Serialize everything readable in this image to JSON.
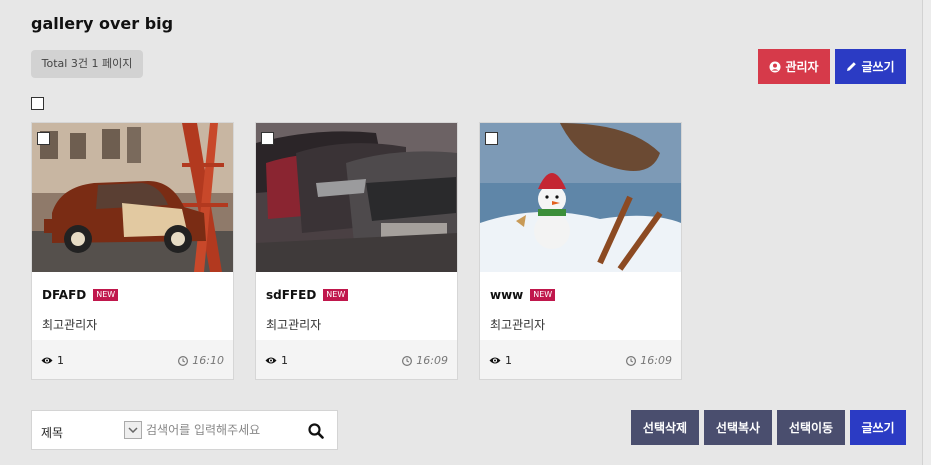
{
  "board": {
    "title": "gallery over big",
    "total_text": "Total 3건 1 페이지"
  },
  "toolbar": {
    "admin_label": "관리자",
    "write_label": "글쓰기"
  },
  "posts": [
    {
      "subject": "DFAFD",
      "new_badge": "NEW",
      "writer": "최고관리자",
      "views": "1",
      "time": "16:10"
    },
    {
      "subject": "sdFFED",
      "new_badge": "NEW",
      "writer": "최고관리자",
      "views": "1",
      "time": "16:09"
    },
    {
      "subject": "www",
      "new_badge": "NEW",
      "writer": "최고관리자",
      "views": "1",
      "time": "16:09"
    }
  ],
  "search": {
    "field_selected": "제목",
    "placeholder": "검색어를 입력해주세요"
  },
  "bottom_actions": {
    "delete_label": "선택삭제",
    "copy_label": "선택복사",
    "move_label": "선택이동",
    "write_label": "글쓰기"
  },
  "colors": {
    "admin_button": "#d63a4a",
    "write_button": "#2b3bc4",
    "action_button": "#4a4e6e",
    "new_badge": "#c0174c"
  }
}
